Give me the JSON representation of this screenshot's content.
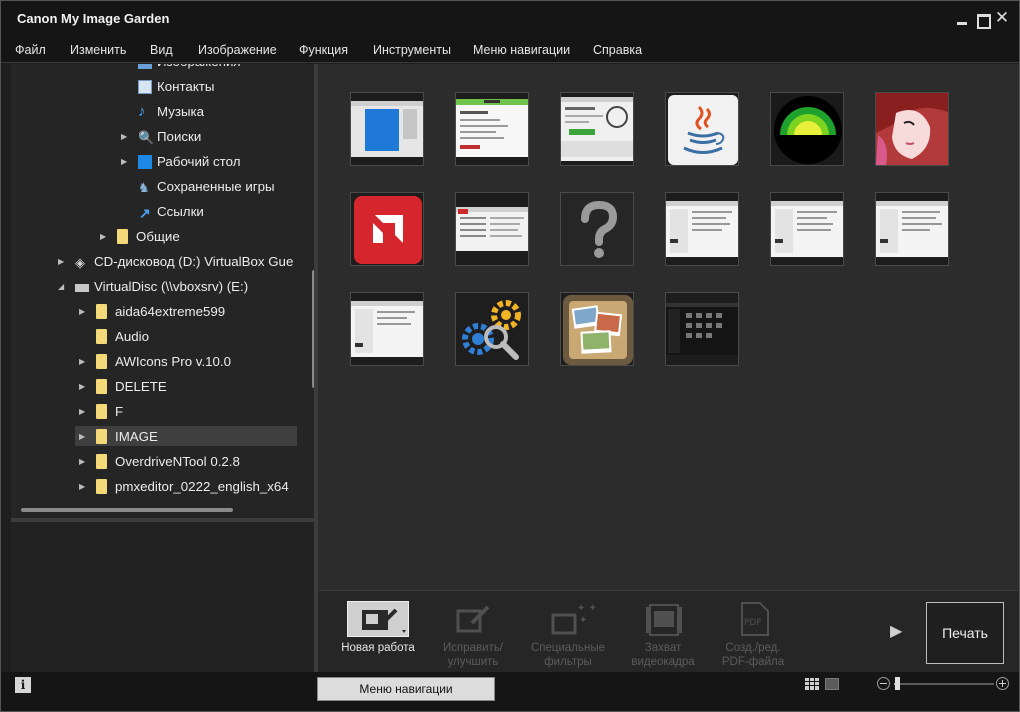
{
  "app": {
    "title": "Canon My Image Garden"
  },
  "menu": [
    "Файл",
    "Изменить",
    "Вид",
    "Изображение",
    "Функция",
    "Инструменты",
    "Меню навигации",
    "Справка"
  ],
  "tree": [
    {
      "label": "Изображения",
      "icon": "pictures-icon",
      "arrow": ""
    },
    {
      "label": "Контакты",
      "icon": "contacts-icon",
      "arrow": ""
    },
    {
      "label": "Музыка",
      "icon": "music-icon",
      "arrow": ""
    },
    {
      "label": "Поиски",
      "icon": "searches-icon",
      "arrow": "▶"
    },
    {
      "label": "Рабочий стол",
      "icon": "desktop-icon",
      "arrow": "▶"
    },
    {
      "label": "Сохраненные игры",
      "icon": "saved-games-icon",
      "arrow": ""
    },
    {
      "label": "Ссылки",
      "icon": "links-icon",
      "arrow": ""
    },
    {
      "label": "Общие",
      "icon": "folder-icon",
      "arrow": "▶"
    },
    {
      "label": "CD-дисковод (D:) VirtualBox Gue",
      "icon": "cd-drive-icon",
      "arrow": "▶"
    },
    {
      "label": "VirtualDisc (\\\\vboxsrv) (E:)",
      "icon": "network-drive-icon",
      "arrow": "◢"
    },
    {
      "label": "aida64extreme599",
      "icon": "folder-icon",
      "arrow": "▶"
    },
    {
      "label": "Audio",
      "icon": "folder-icon",
      "arrow": ""
    },
    {
      "label": "AWIcons Pro v.10.0",
      "icon": "folder-icon",
      "arrow": "▶"
    },
    {
      "label": "DELETE",
      "icon": "folder-icon",
      "arrow": "▶"
    },
    {
      "label": "F",
      "icon": "folder-icon",
      "arrow": "▶"
    },
    {
      "label": "IMAGE",
      "icon": "folder-icon",
      "arrow": "▶",
      "selected": true
    },
    {
      "label": "OverdriveNTool 0.2.8",
      "icon": "folder-icon",
      "arrow": "▶"
    },
    {
      "label": "pmxeditor_0222_english_x64",
      "icon": "folder-icon",
      "arrow": "▶"
    }
  ],
  "thumbnails": [
    {
      "icon": "windows-tile-thumbnail"
    },
    {
      "icon": "webpage-screenshot-thumbnail"
    },
    {
      "icon": "router-page-thumbnail"
    },
    {
      "icon": "java-logo-thumbnail"
    },
    {
      "icon": "green-rings-logo-thumbnail"
    },
    {
      "icon": "anime-drawing-thumbnail"
    },
    {
      "icon": "amd-logo-thumbnail"
    },
    {
      "icon": "program-window-thumbnail"
    },
    {
      "icon": "question-mark-thumbnail"
    },
    {
      "icon": "program-window-thumbnail"
    },
    {
      "icon": "program-window-thumbnail"
    },
    {
      "icon": "program-window-thumbnail"
    },
    {
      "icon": "program-window-thumbnail"
    },
    {
      "icon": "gears-search-thumbnail"
    },
    {
      "icon": "photo-collage-thumbnail"
    },
    {
      "icon": "dark-app-thumbnail"
    }
  ],
  "toolbar": {
    "tools": [
      {
        "label": "Новая работа",
        "icon": "new-work-icon",
        "active": true
      },
      {
        "label": "Исправить/\nулучшить",
        "icon": "fix-enhance-icon",
        "active": false
      },
      {
        "label": "Специальные\nфильтры",
        "icon": "special-filters-icon",
        "active": false
      },
      {
        "label": "Захват\nвидеокадра",
        "icon": "video-capture-icon",
        "active": false
      },
      {
        "label": "Созд./ред.\nPDF-файла",
        "icon": "pdf-icon",
        "active": false
      }
    ],
    "print_label": "Печать",
    "pdf_badge": "PDF"
  },
  "status": {
    "info_label": "i",
    "nav_menu_label": "Меню навигации",
    "zoom_level": 0.02
  }
}
